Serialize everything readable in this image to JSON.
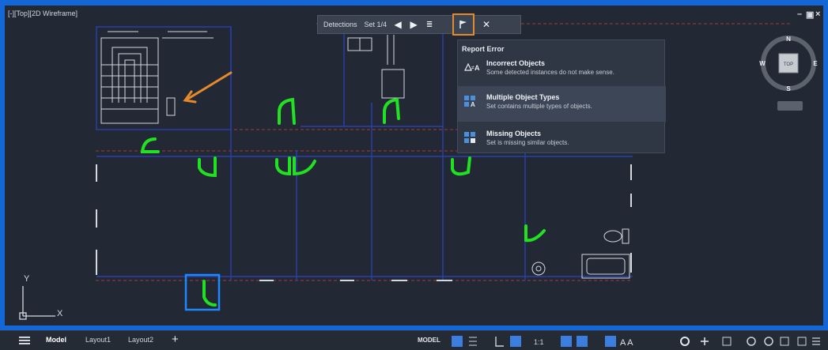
{
  "viewport": {
    "label": "[-][Top][2D Wireframe]",
    "controls": {
      "minimize": "–",
      "restore": "▣",
      "close": "×"
    }
  },
  "toolbar": {
    "label": "Detections",
    "set_text": "Set 1/4",
    "report_icon": "flag-icon"
  },
  "report_menu": {
    "header": "Report Error",
    "items": [
      {
        "title": "Incorrect Objects",
        "description": "Some detected instances do not make sense.",
        "icon": "incorrect-objects-icon"
      },
      {
        "title": "Multiple Object Types",
        "description": "Set contains multiple types of objects.",
        "icon": "multiple-types-icon"
      },
      {
        "title": "Missing Objects",
        "description": "Set is missing similar objects.",
        "icon": "missing-objects-icon"
      }
    ]
  },
  "viewcube": {
    "top": "TOP",
    "north": "N",
    "south": "S",
    "east": "E",
    "west": "W"
  },
  "axes": {
    "y": "Y",
    "x": "X"
  },
  "statusbar": {
    "tabs": [
      "Model",
      "Layout1",
      "Layout2"
    ],
    "active_tab": "Model",
    "model_label": "MODEL",
    "scale_label": "1:1"
  },
  "colors": {
    "accent_blue": "#1467d6",
    "highlight_orange": "#e48a2c",
    "detection_green": "#22e022",
    "wall_blue": "#2a3fae",
    "wall_red": "#a83a34",
    "line_white": "#d5d9de"
  }
}
